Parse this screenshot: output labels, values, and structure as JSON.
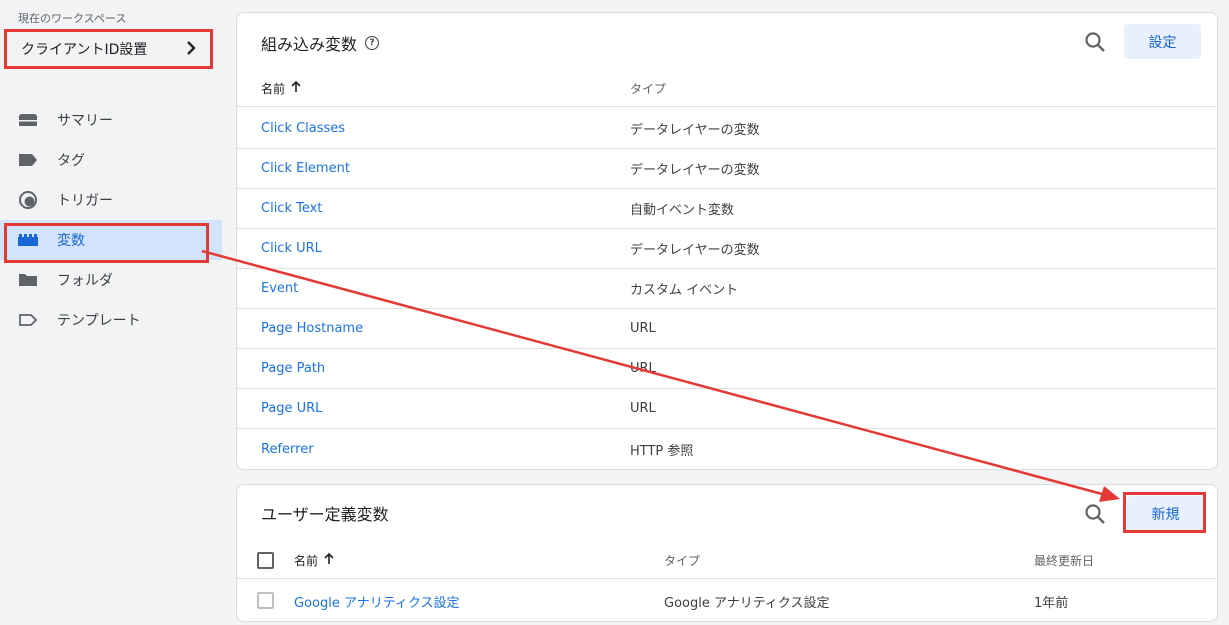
{
  "sidebar": {
    "workspace_label": "現在のワークスペース",
    "workspace_name": "クライアントID設置",
    "items": [
      {
        "label": "サマリー",
        "icon": "summary-icon"
      },
      {
        "label": "タグ",
        "icon": "tag-icon"
      },
      {
        "label": "トリガー",
        "icon": "trigger-icon"
      },
      {
        "label": "変数",
        "icon": "variables-icon",
        "active": true
      },
      {
        "label": "フォルダ",
        "icon": "folder-icon"
      },
      {
        "label": "テンプレート",
        "icon": "template-icon"
      }
    ]
  },
  "builtin": {
    "title": "組み込み変数",
    "configure_label": "設定",
    "col_name": "名前",
    "col_type": "タイプ",
    "rows": [
      {
        "name": "Click Classes",
        "type": "データレイヤーの変数"
      },
      {
        "name": "Click Element",
        "type": "データレイヤーの変数"
      },
      {
        "name": "Click Text",
        "type": "自動イベント変数"
      },
      {
        "name": "Click URL",
        "type": "データレイヤーの変数"
      },
      {
        "name": "Event",
        "type": "カスタム イベント"
      },
      {
        "name": "Page Hostname",
        "type": "URL"
      },
      {
        "name": "Page Path",
        "type": "URL"
      },
      {
        "name": "Page URL",
        "type": "URL"
      },
      {
        "name": "Referrer",
        "type": "HTTP 参照"
      }
    ]
  },
  "user_defined": {
    "title": "ユーザー定義変数",
    "new_label": "新規",
    "col_name": "名前",
    "col_type": "タイプ",
    "col_updated": "最終更新日",
    "rows": [
      {
        "name": "Google アナリティクス設定",
        "type": "Google アナリティクス設定",
        "updated": "1年前"
      }
    ]
  },
  "colors": {
    "accent": "#1a73e8",
    "active_bg": "#d2e3fc",
    "annotation": "#e53935"
  }
}
